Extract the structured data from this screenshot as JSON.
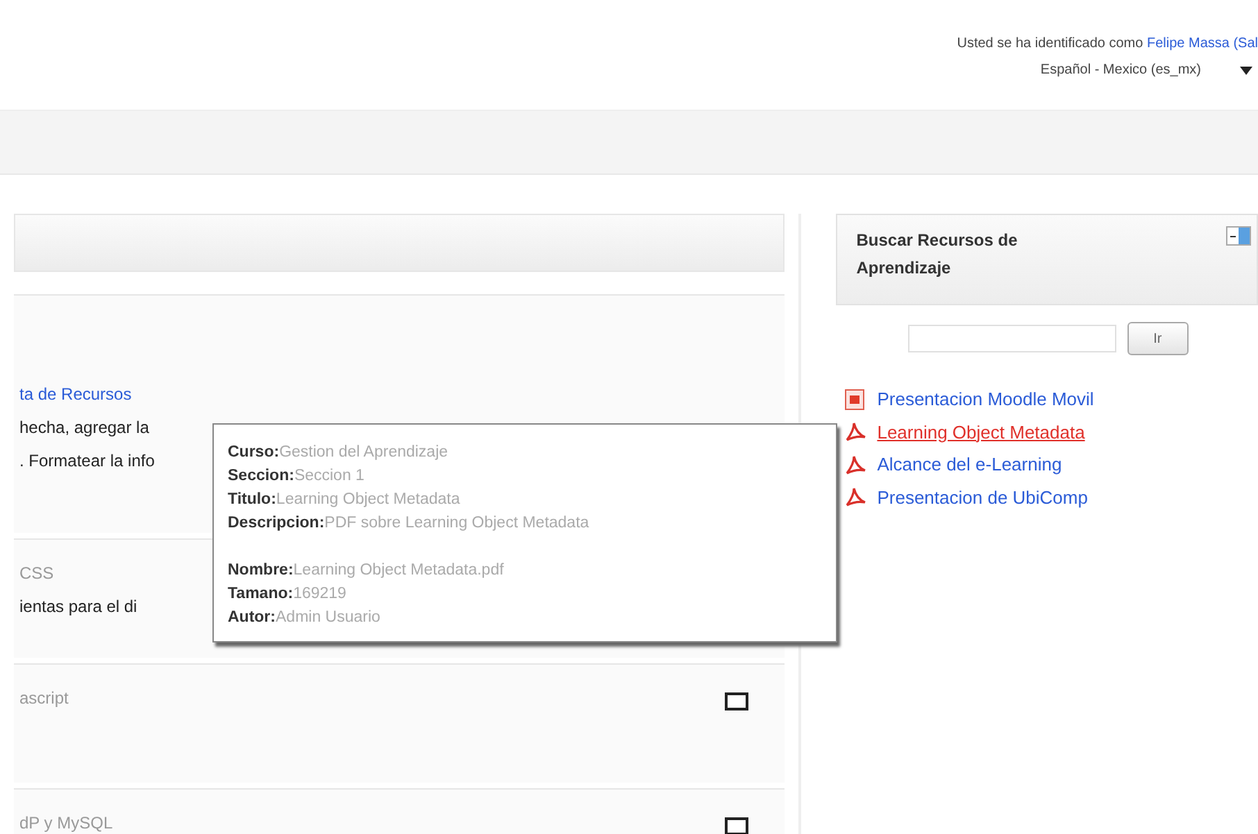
{
  "header": {
    "login_text": "Usted se ha identificado como",
    "user_link": "Felipe Massa (Sal",
    "language": "Español - Mexico (es_mx)"
  },
  "sections": [
    {
      "kind": "header"
    },
    {
      "kind": "content",
      "link": "ta de Recursos",
      "lines": [
        "hecha, agregar la",
        ". Formatear la info"
      ]
    },
    {
      "kind": "content",
      "title": "CSS",
      "lines": [
        "ientas para el di"
      ]
    },
    {
      "kind": "content",
      "title": "ascript",
      "checked": false
    },
    {
      "kind": "content",
      "title": "dP y MySQL",
      "checked": false
    }
  ],
  "tooltip": [
    {
      "label": "Curso:",
      "value": "Gestion del Aprendizaje"
    },
    {
      "label": "Seccion:",
      "value": "Seccion 1"
    },
    {
      "label": "Titulo:",
      "value": "Learning Object Metadata"
    },
    {
      "label": "Descripcion:",
      "value": "PDF sobre Learning Object Metadata"
    },
    {
      "label": "Nombre:",
      "value": "Learning Object Metadata.pdf",
      "gap": true
    },
    {
      "label": "Tamano:",
      "value": "169219"
    },
    {
      "label": "Autor:",
      "value": "Admin Usuario"
    }
  ],
  "block": {
    "title": "Buscar Recursos de Aprendizaje",
    "button": "Ir",
    "items": [
      {
        "kind": "presentation",
        "label": "Presentacion Moodle Movil",
        "selected": false
      },
      {
        "kind": "pdf",
        "label": "Learning Object Metadata",
        "selected": true
      },
      {
        "kind": "pdf",
        "label": "Alcance del e-Learning",
        "selected": false
      },
      {
        "kind": "pdf",
        "label": "Presentacion de UbiComp",
        "selected": false
      }
    ]
  }
}
